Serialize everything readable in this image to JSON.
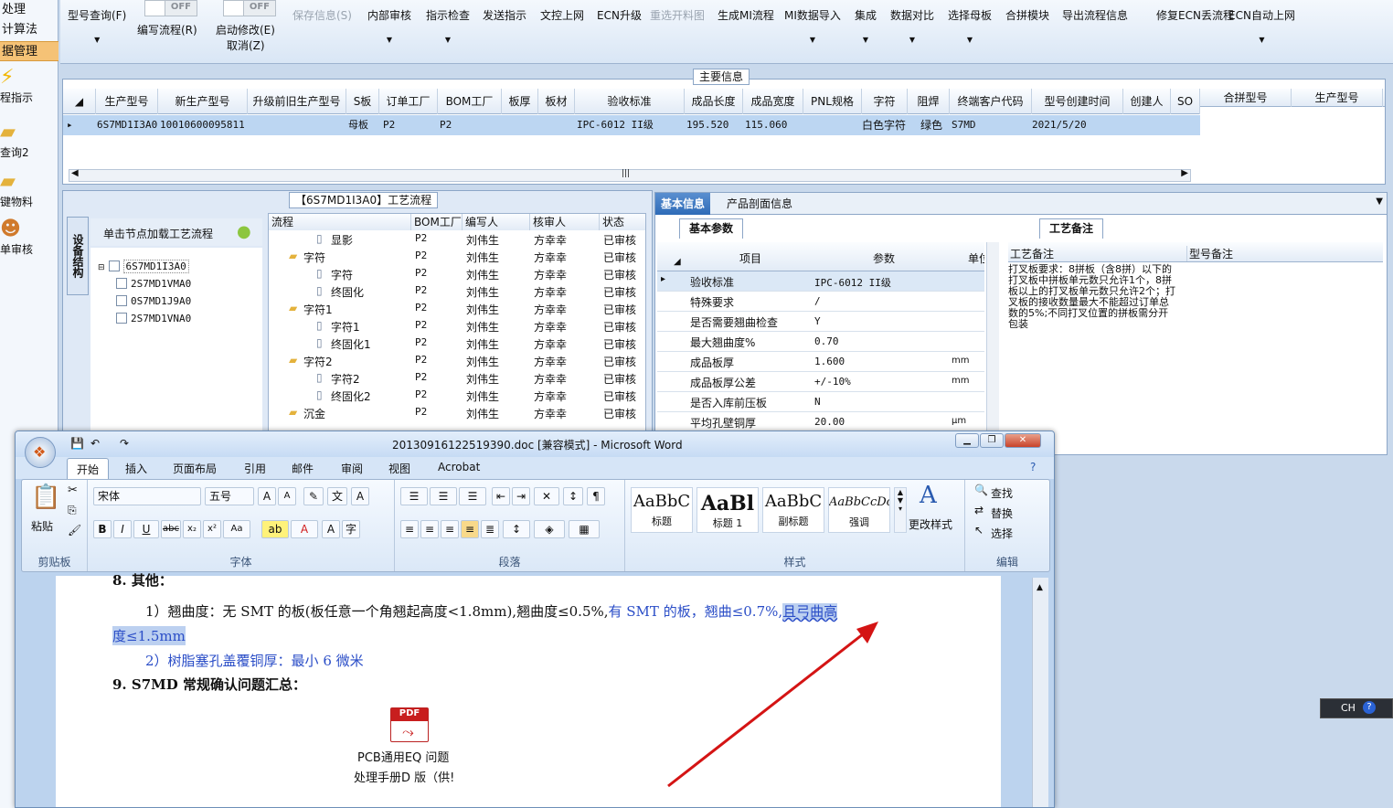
{
  "left_nav": {
    "top_label": "处理",
    "item_calc": "计算法",
    "item_data_manage": "据管理",
    "items": [
      {
        "label": "程指示",
        "icon": "lightning-icon"
      },
      {
        "label": "查询2",
        "icon": "folder-icon"
      },
      {
        "label": "键物料",
        "icon": "folder-icon"
      },
      {
        "label": "单审核",
        "icon": "user-icon"
      }
    ]
  },
  "toolbar": {
    "model_query": "型号查询(F)",
    "edit_flow": "编写流程(R)",
    "start_modify": "启动修改(E)",
    "cancel": "取消(Z)",
    "save_info": "保存信息(S)",
    "internal_audit": "内部审核",
    "indicator_check": "指示检查",
    "send_indicator": "发送指示",
    "doc_upload": "文控上网",
    "ecn_upgrade": "ECN升级",
    "reselect_drawing": "重选开料图",
    "gen_mi_flow": "生成MI流程",
    "mi_import": "MI数据导入",
    "integrate": "集成",
    "data_compare": "数据对比",
    "select_master": "选择母板",
    "merge_module": "合拼模块",
    "export_flow": "导出流程信息",
    "fix_ecn": "修复ECN丢流程",
    "ecn_auto": "ECN自动上网",
    "toggle_off_1": "OFF",
    "toggle_off_2": "OFF"
  },
  "main_info": {
    "title": "主要信息",
    "headers": [
      "生产型号",
      "新生产型号",
      "升级前旧生产型号",
      "S板",
      "订单工厂",
      "BOM工厂",
      "板厚",
      "板材",
      "验收标准",
      "成品长度",
      "成品宽度",
      "PNL规格",
      "字符",
      "阻焊",
      "终端客户代码",
      "型号创建时间",
      "创建人",
      "SO"
    ],
    "right_headers": [
      "合拼型号",
      "生产型号"
    ],
    "row": {
      "prod_model": "6S7MD1I3A0",
      "new_model": "10010600095811",
      "s_board": "母板",
      "order_factory": "P2",
      "bom_factory": "P2",
      "standard": "IPC-6012 II级",
      "length": "195.520",
      "width": "115.060",
      "char": "白色字符",
      "mask": "绿色",
      "customer": "S7MD",
      "created": "2021/5/20"
    }
  },
  "process": {
    "title": "【6S7MD1I3A0】工艺流程",
    "vertical_tab": "设备结构",
    "load_hint": "单击节点加载工艺流程",
    "tree": [
      "6S7MD1I3A0",
      "2S7MD1VMA0",
      "0S7MD1J9A0",
      "2S7MD1VNA0"
    ],
    "flow_headers": [
      "流程",
      "BOM工厂",
      "编写人",
      "核审人",
      "状态"
    ],
    "flow_rows": [
      {
        "name": "显影",
        "bom": "P2",
        "writer": "刘伟生",
        "reviewer": "方幸幸",
        "status": "已审核",
        "level": 2,
        "type": "doc"
      },
      {
        "name": "字符",
        "bom": "P2",
        "writer": "刘伟生",
        "reviewer": "方幸幸",
        "status": "已审核",
        "level": 1,
        "type": "folder"
      },
      {
        "name": "字符",
        "bom": "P2",
        "writer": "刘伟生",
        "reviewer": "方幸幸",
        "status": "已审核",
        "level": 2,
        "type": "doc"
      },
      {
        "name": "终固化",
        "bom": "P2",
        "writer": "刘伟生",
        "reviewer": "方幸幸",
        "status": "已审核",
        "level": 2,
        "type": "doc"
      },
      {
        "name": "字符1",
        "bom": "P2",
        "writer": "刘伟生",
        "reviewer": "方幸幸",
        "status": "已审核",
        "level": 1,
        "type": "folder"
      },
      {
        "name": "字符1",
        "bom": "P2",
        "writer": "刘伟生",
        "reviewer": "方幸幸",
        "status": "已审核",
        "level": 2,
        "type": "doc"
      },
      {
        "name": "终固化1",
        "bom": "P2",
        "writer": "刘伟生",
        "reviewer": "方幸幸",
        "status": "已审核",
        "level": 2,
        "type": "doc"
      },
      {
        "name": "字符2",
        "bom": "P2",
        "writer": "刘伟生",
        "reviewer": "方幸幸",
        "status": "已审核",
        "level": 1,
        "type": "folder"
      },
      {
        "name": "字符2",
        "bom": "P2",
        "writer": "刘伟生",
        "reviewer": "方幸幸",
        "status": "已审核",
        "level": 2,
        "type": "doc"
      },
      {
        "name": "终固化2",
        "bom": "P2",
        "writer": "刘伟生",
        "reviewer": "方幸幸",
        "status": "已审核",
        "level": 2,
        "type": "doc"
      },
      {
        "name": "沉金",
        "bom": "P2",
        "writer": "刘伟生",
        "reviewer": "方幸幸",
        "status": "已审核",
        "level": 1,
        "type": "folder"
      }
    ]
  },
  "basic": {
    "tab_basic": "基本信息",
    "tab_profile": "产品剖面信息",
    "sub_params": "基本参数",
    "sub_remarks": "工艺备注",
    "col_item": "项目",
    "col_param": "参数",
    "col_unit": "单位",
    "params": [
      {
        "k": "验收标准",
        "v": "IPC-6012 II级",
        "u": ""
      },
      {
        "k": "特殊要求",
        "v": "/",
        "u": ""
      },
      {
        "k": "是否需要翘曲检查",
        "v": "Y",
        "u": ""
      },
      {
        "k": "最大翘曲度%",
        "v": "0.70",
        "u": ""
      },
      {
        "k": "成品板厚",
        "v": "1.600",
        "u": "mm"
      },
      {
        "k": "成品板厚公差",
        "v": "+/-10%",
        "u": "mm"
      },
      {
        "k": "是否入库前压板",
        "v": "N",
        "u": ""
      },
      {
        "k": "平均孔壁铜厚",
        "v": "20.00",
        "u": "μm"
      }
    ],
    "remark_col1": "工艺备注",
    "remark_col2": "型号备注",
    "remark_text": "打叉板要求：8拼板（含8拼）以下的打叉板中拼板单元数只允许1个，8拼板以上的打叉板单元数只允许2个；打叉板的接收数量最大不能超过订单总数的5%;不同打叉位置的拼板需分开包装"
  },
  "word": {
    "title": "20130916122519390.doc [兼容模式] - Microsoft Word",
    "tabs": [
      "开始",
      "插入",
      "页面布局",
      "引用",
      "邮件",
      "审阅",
      "视图",
      "Acrobat"
    ],
    "font_name": "宋体",
    "font_size": "五号",
    "paste": "粘贴",
    "clipboard": "剪贴板",
    "font_group": "字体",
    "paragraph_group": "段落",
    "styles_group": "样式",
    "edit_group": "编辑",
    "styles": [
      {
        "preview": "AaBbC",
        "name": "标题"
      },
      {
        "preview": "AaBl",
        "name": "标题 1"
      },
      {
        "preview": "AaBbC",
        "name": "副标题"
      },
      {
        "preview": "AaBbCcDc",
        "name": "强调"
      }
    ],
    "change_styles": "更改样式",
    "find": "查找",
    "replace": "替换",
    "select": "选择",
    "doc": {
      "heading8": "8.  其他：",
      "line1_a": "1）翘曲度：无 SMT 的板(板任意一个角翘起高度<1.8mm),翘曲度≤0.5%,",
      "line1_b": "有 SMT 的板，翘曲≤0.7%,",
      "line1_c": "且弓曲高",
      "line2": "度≤1.5mm",
      "line3": "2）树脂塞孔盖覆铜厚：最小 6 微米",
      "heading9": "9.   S7MD 常规确认问题汇总：",
      "pdf_label1": "PCB通用EQ 问题",
      "pdf_label2": "处理手册D 版（供!",
      "pdf_badge": "PDF"
    }
  },
  "ime": {
    "label": "CH"
  }
}
